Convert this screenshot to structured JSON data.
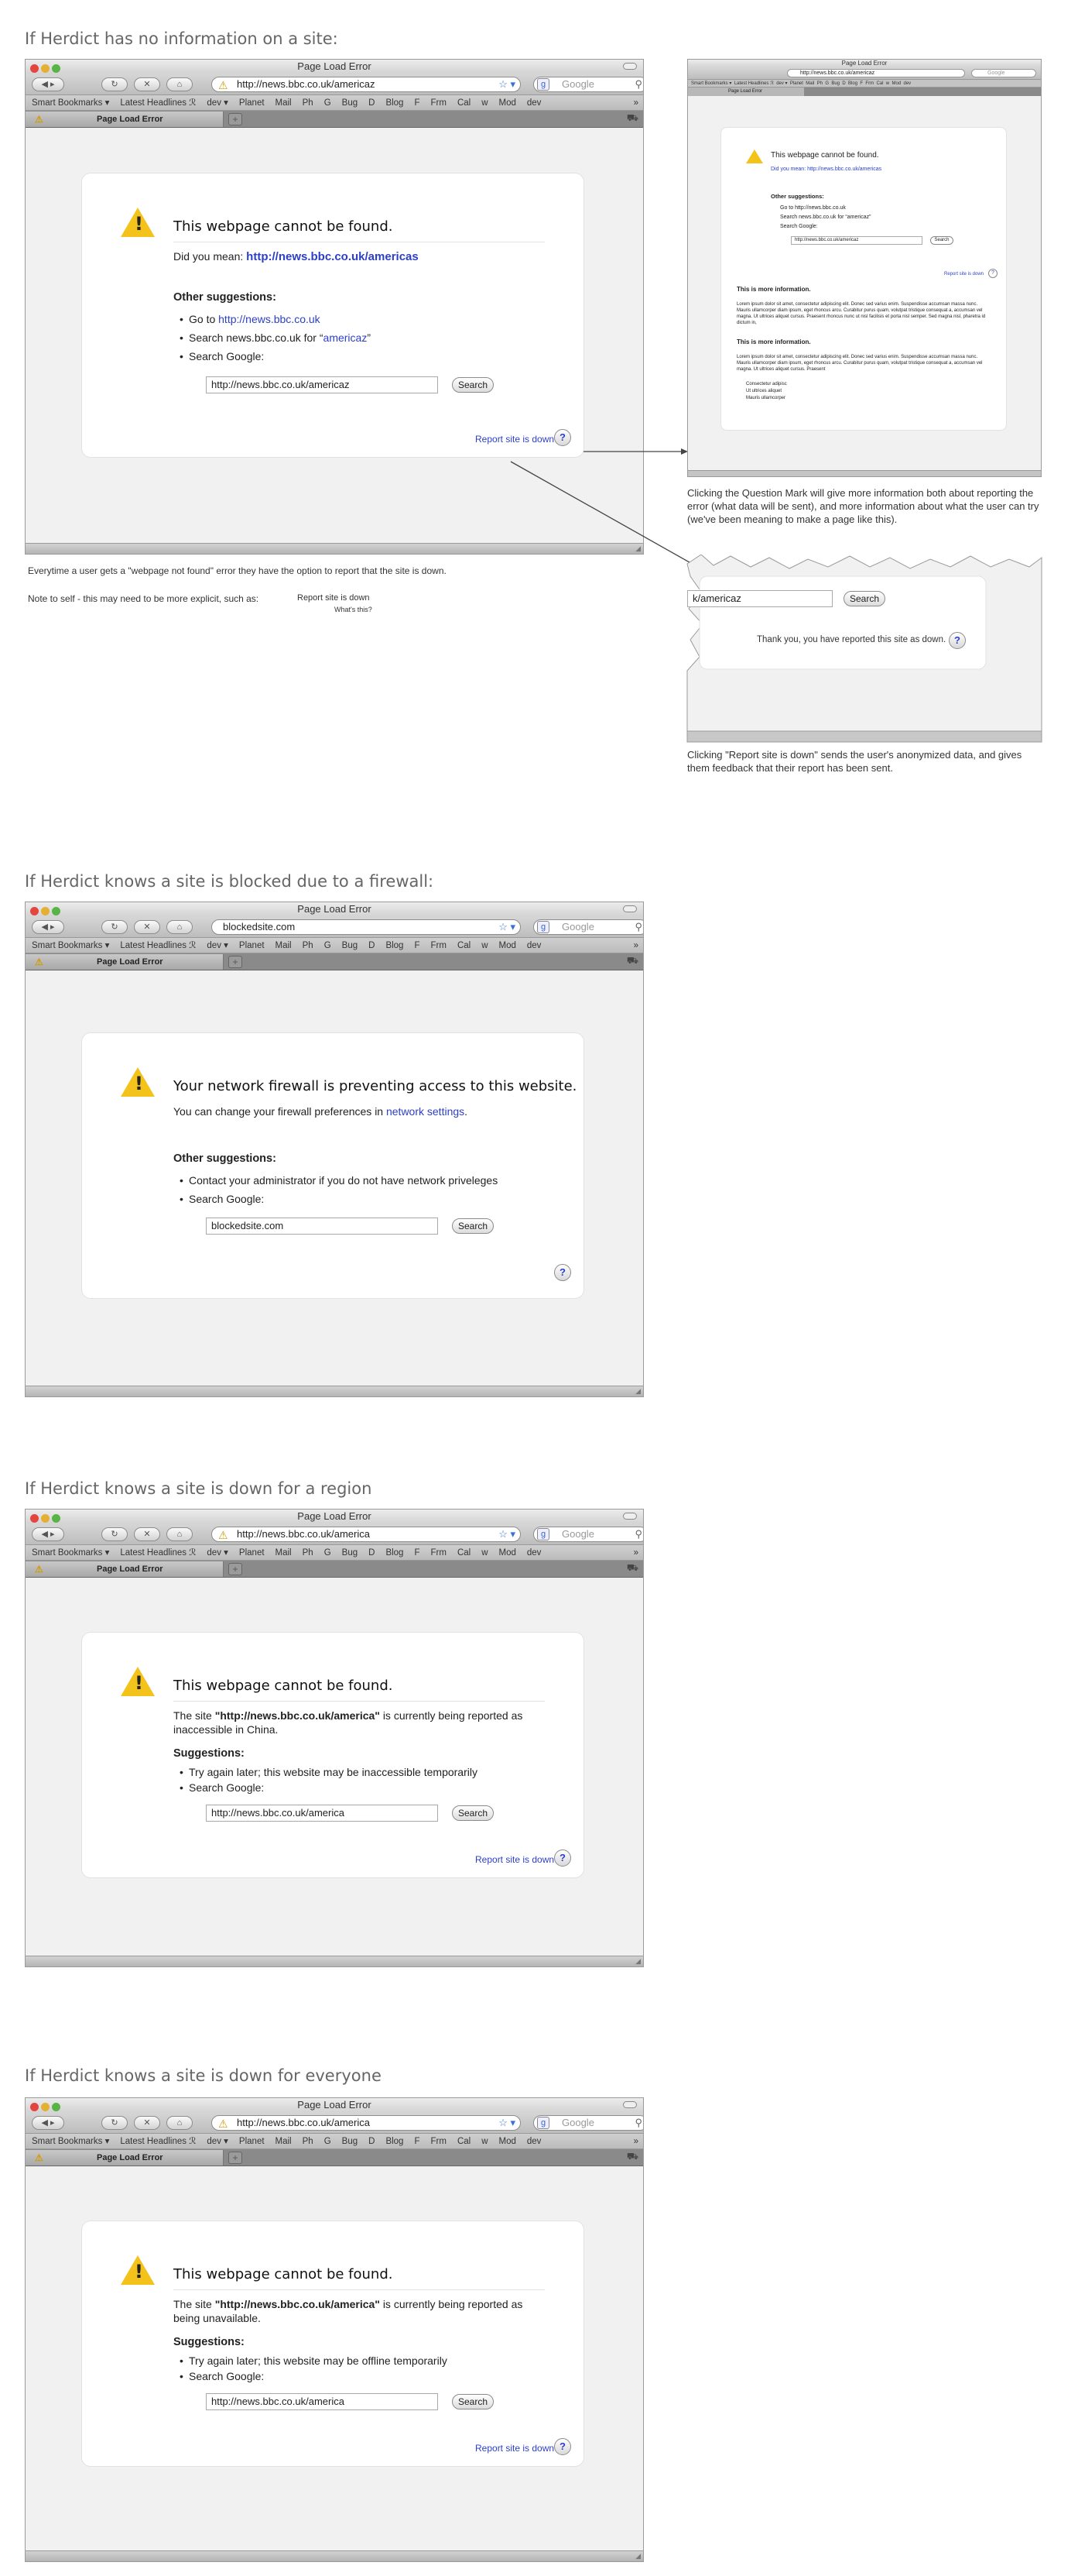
{
  "browser": {
    "window_title": "Page Load Error",
    "tab_label": "Page Load Error",
    "search_placeholder": "Google",
    "bookmarks": [
      "Smart Bookmarks ▾",
      "Latest Headlines ℛ",
      "dev ▾",
      "Planet",
      "Mail",
      "Ph",
      "G",
      "Bug",
      "D",
      "Blog",
      "F",
      "Frm",
      "Cal",
      "w",
      "Mod",
      "dev"
    ],
    "bookmarks_more": "»",
    "search_button": "Search",
    "help_mark": "?"
  },
  "section1": {
    "heading": "If Herdict has no information on a site:",
    "url": "http://news.bbc.co.uk/americaz",
    "title": "This webpage cannot be found.",
    "did_you_mean_label": "Did you mean:",
    "did_you_mean_link": "http://news.bbc.co.uk/americas",
    "suggestions_heading": "Other suggestions:",
    "sug_go_label": "Go to",
    "sug_go_link": "http://news.bbc.co.uk",
    "sug_search_label": "Search news.bbc.co.uk for “",
    "sug_search_term": "americaz",
    "sug_search_end": "”",
    "sug_google": "Search Google:",
    "search_value": "http://news.bbc.co.uk/americaz",
    "report_link": "Report site is down",
    "note1": "Everytime a user gets a \"webpage not found\" error they have the option to report that the site is down.",
    "note2": "Note to self - this may need to be more explicit, such as:",
    "note2_link": "Report site is down",
    "note2_sub": "What's this?"
  },
  "mini": {
    "url": "http://news.bbc.co.uk/americaz",
    "title": "This webpage cannot be found.",
    "did_you_mean": "Did you mean: http://news.bbc.co.uk/americas",
    "suggestions_heading": "Other suggestions:",
    "sug1": "Go to http://news.bbc.co.uk",
    "sug2": "Search news.bbc.co.uk for “americaz”",
    "sug3": "Search Google:",
    "search_value": "http://news.bbc.co.uk/americaz",
    "report_link": "Report site is down",
    "more_info_1": "This is more information.",
    "lorem1": "Lorem ipsum dolor sit amet, consectetur adipiscing elit. Donec sed varius enim. Suspendisse accumsan massa nunc. Mauris ullamcorper diam ipsum, eget rhoncus arcu. Curabitur purus quam, volutpat tristique consequat a, accumsan vel magna. Ut ultrices aliquet cursus. Praesent rhoncus nunc ut nisl facilisis et porta nisl semper. Sed magna nisl, pharetra id dictum in,",
    "more_info_2": "This is more information.",
    "lorem2": "Lorem ipsum dolor sit amet, consectetur adipiscing elit. Donec sed varius enim. Suspendisse accumsan massa nunc. Mauris ullamcorper diam ipsum, eget rhoncus arcu. Curabitur purus quam, volutpat tristique consequat a, accumsan vel magna. Ut ultrices aliquet cursus. Praesent",
    "bullets": [
      "Consectetur adipisc",
      "Ut ultrices aliquet",
      "Mauris ullamcorper"
    ],
    "caption": "Clicking the Question Mark will give more information both about reporting the error (what data will be sent), and more information about what the user can try (we've been meaning to make a page like this)."
  },
  "crop": {
    "search_value": "k/americaz",
    "thanks": "Thank you, you have reported this site as down.",
    "caption": "Clicking \"Report site is down\" sends the user's anonymized data, and gives them feedback that their report has been sent."
  },
  "section2": {
    "heading": "If Herdict knows a site is blocked due to a firewall:",
    "url": "blockedsite.com",
    "title": "Your network firewall is preventing access to this website.",
    "text_pre": "You can change your firewall preferences in",
    "text_link": "network settings",
    "text_post": ".",
    "suggestions_heading": "Other suggestions:",
    "sug1": "Contact your administrator if you do not have network priveleges",
    "sug2": "Search Google:",
    "search_value": "blockedsite.com"
  },
  "section3": {
    "heading": "If Herdict knows a site is down for a region",
    "url": "http://news.bbc.co.uk/america",
    "title": "This webpage cannot be found.",
    "text_pre": "The site",
    "text_bold": "\"http://news.bbc.co.uk/america\"",
    "text_post": "is currently being reported as inaccessible in China.",
    "suggestions_heading": "Suggestions:",
    "sug1": "Try again later; this website may be inaccessible temporarily",
    "sug2": "Search Google:",
    "search_value": "http://news.bbc.co.uk/america",
    "report_link": "Report site is down"
  },
  "section4": {
    "heading": "If Herdict knows a site is down for everyone",
    "url": "http://news.bbc.co.uk/america",
    "title": "This webpage cannot be found.",
    "text_pre": "The site",
    "text_bold": "\"http://news.bbc.co.uk/america\"",
    "text_post": "is currently being reported as being unavailable.",
    "suggestions_heading": "Suggestions:",
    "sug1": "Try again later; this website may be offline temporarily",
    "sug2": "Search Google:",
    "search_value": "http://news.bbc.co.uk/america",
    "report_link": "Report site is down"
  }
}
